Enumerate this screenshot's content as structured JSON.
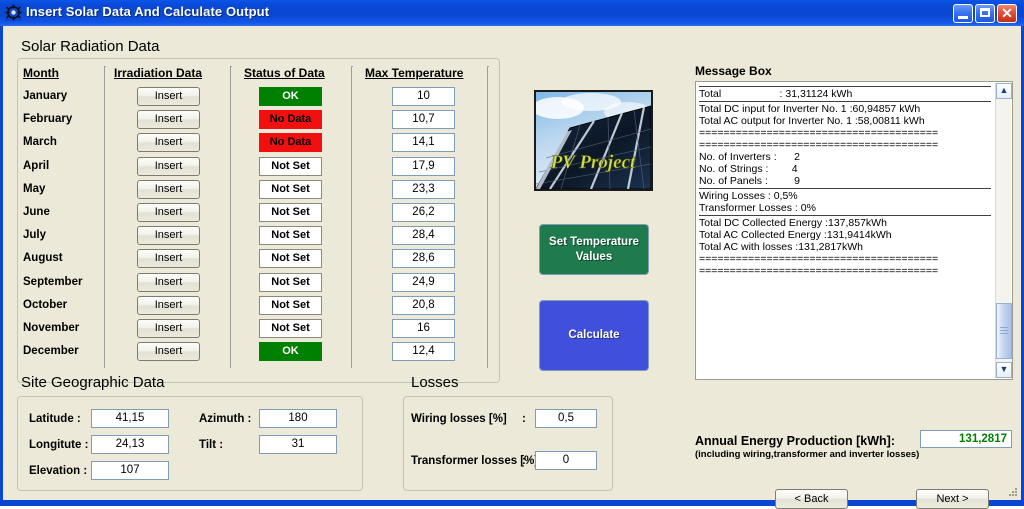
{
  "window": {
    "title": "Insert Solar Data And Calculate Output",
    "icon": "gear-icon",
    "minimize_label": "",
    "maximize_label": "",
    "close_label": "✕"
  },
  "solar_radiation": {
    "group_title": "Solar Radiation Data",
    "columns": [
      "Month",
      "Irradiation Data",
      "Status of Data",
      "Max Temperature"
    ],
    "rows": [
      {
        "month": "January",
        "insert": "Insert",
        "status": "OK",
        "status_kind": "ok",
        "temp": "10"
      },
      {
        "month": "February",
        "insert": "Insert",
        "status": "No Data",
        "status_kind": "nodata",
        "temp": "10,7"
      },
      {
        "month": "March",
        "insert": "Insert",
        "status": "No Data",
        "status_kind": "nodata",
        "temp": "14,1"
      },
      {
        "month": "April",
        "insert": "Insert",
        "status": "Not Set",
        "status_kind": "notset",
        "temp": "17,9"
      },
      {
        "month": "May",
        "insert": "Insert",
        "status": "Not Set",
        "status_kind": "notset",
        "temp": "23,3"
      },
      {
        "month": "June",
        "insert": "Insert",
        "status": "Not Set",
        "status_kind": "notset",
        "temp": "26,2"
      },
      {
        "month": "July",
        "insert": "Insert",
        "status": "Not Set",
        "status_kind": "notset",
        "temp": "28,4"
      },
      {
        "month": "August",
        "insert": "Insert",
        "status": "Not Set",
        "status_kind": "notset",
        "temp": "28,6"
      },
      {
        "month": "September",
        "insert": "Insert",
        "status": "Not Set",
        "status_kind": "notset",
        "temp": "24,9"
      },
      {
        "month": "October",
        "insert": "Insert",
        "status": "Not Set",
        "status_kind": "notset",
        "temp": "20,8"
      },
      {
        "month": "November",
        "insert": "Insert",
        "status": "Not Set",
        "status_kind": "notset",
        "temp": "16"
      },
      {
        "month": "December",
        "insert": "Insert",
        "status": "OK",
        "status_kind": "ok",
        "temp": "12,4"
      }
    ]
  },
  "center": {
    "image_caption": "PV Project",
    "set_temperature_label": "Set Temperature\nValues",
    "calculate_label": "Calculate"
  },
  "message_box": {
    "label": "Message Box",
    "lines": [
      {
        "kind": "rule"
      },
      {
        "kind": "text",
        "text": "Total                    : 31,31124 kWh"
      },
      {
        "kind": "rule"
      },
      {
        "kind": "text",
        "text": ""
      },
      {
        "kind": "text",
        "text": ""
      },
      {
        "kind": "text",
        "text": "Total DC input for Inverter No. 1 :60,94857 kWh"
      },
      {
        "kind": "text",
        "text": "Total AC output for Inverter No. 1 :58,00811 kWh"
      },
      {
        "kind": "text",
        "text": ""
      },
      {
        "kind": "text",
        "text": "======================================="
      },
      {
        "kind": "text",
        "text": "======================================="
      },
      {
        "kind": "text",
        "text": "No. of Inverters :      2"
      },
      {
        "kind": "text",
        "text": "No. of Strings :        4"
      },
      {
        "kind": "text",
        "text": "No. of Panels :         9"
      },
      {
        "kind": "text",
        "text": ""
      },
      {
        "kind": "rule"
      },
      {
        "kind": "text",
        "text": "Wiring Losses : 0,5%"
      },
      {
        "kind": "text",
        "text": "Transformer Losses : 0%"
      },
      {
        "kind": "text",
        "text": ""
      },
      {
        "kind": "rule"
      },
      {
        "kind": "text",
        "text": "Total DC Collected Energy :137,857kWh"
      },
      {
        "kind": "text",
        "text": "Total AC Collected Energy :131,9414kWh"
      },
      {
        "kind": "text",
        "text": "Total AC with losses :131,2817kWh"
      },
      {
        "kind": "text",
        "text": "======================================="
      },
      {
        "kind": "text",
        "text": "======================================="
      }
    ],
    "scroll_up_icon": "chevron-up-icon",
    "scroll_down_icon": "chevron-down-icon"
  },
  "site_geographic": {
    "group_title": "Site Geographic Data",
    "fields": [
      {
        "label": "Latitude   :",
        "value": "41,15"
      },
      {
        "label": "Longitute :",
        "value": "24,13"
      },
      {
        "label": "Elevation :",
        "value": "107"
      },
      {
        "label": "Azimuth :",
        "value": "180"
      },
      {
        "label": "Tilt         :",
        "value": "31"
      }
    ]
  },
  "losses": {
    "group_title": "Losses",
    "fields": [
      {
        "label": "Wiring losses [%]",
        "sep": ":",
        "value": "0,5"
      },
      {
        "label": "Transformer losses [%]",
        "sep": ":",
        "value": "0"
      }
    ]
  },
  "summary": {
    "annual_label": "Annual Energy Production [kWh]:",
    "annual_sub": "(including wiring,transformer and inverter losses)",
    "annual_value": "131,2817",
    "annual_value_color": "#008000",
    "back_label": "< Back",
    "next_label": "Next >"
  }
}
